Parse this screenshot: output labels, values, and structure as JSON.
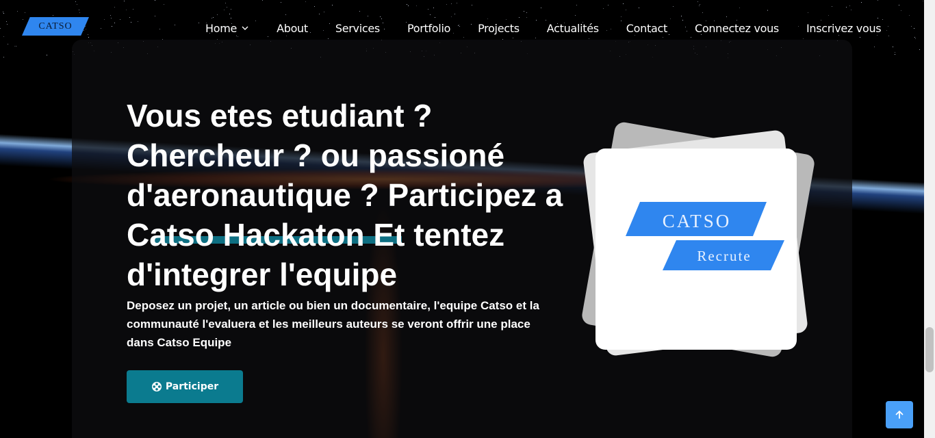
{
  "brand": {
    "logo_text": "CATSO",
    "accent": "#2f86ef"
  },
  "nav": {
    "items": [
      {
        "label": "Home"
      },
      {
        "label": "About"
      },
      {
        "label": "Services"
      },
      {
        "label": "Portfolio"
      },
      {
        "label": "Projects"
      },
      {
        "label": "Actualités"
      },
      {
        "label": "Contact"
      },
      {
        "label": "Connectez vous"
      },
      {
        "label": "Inscrivez vous"
      }
    ]
  },
  "hero": {
    "title": "Vous etes etudiant ? Chercheur ? ou passioné d'aeronautique ? Participez a Catso Hackaton Et tentez d'integrer l'equipe",
    "subtitle": "Deposez un projet, un article ou bien un documentaire, l'equipe Catso et la communauté l'evaluera et les meilleurs auteurs se veront offrir une place dans Catso Equipe",
    "button_label": "Participer",
    "button_color": "#0b7b8f",
    "image": {
      "logo_top": "CATSO",
      "logo_bottom": "Recrute"
    }
  },
  "back_to_top": {
    "icon": "arrow-up-icon",
    "color": "#4aa0f8"
  }
}
